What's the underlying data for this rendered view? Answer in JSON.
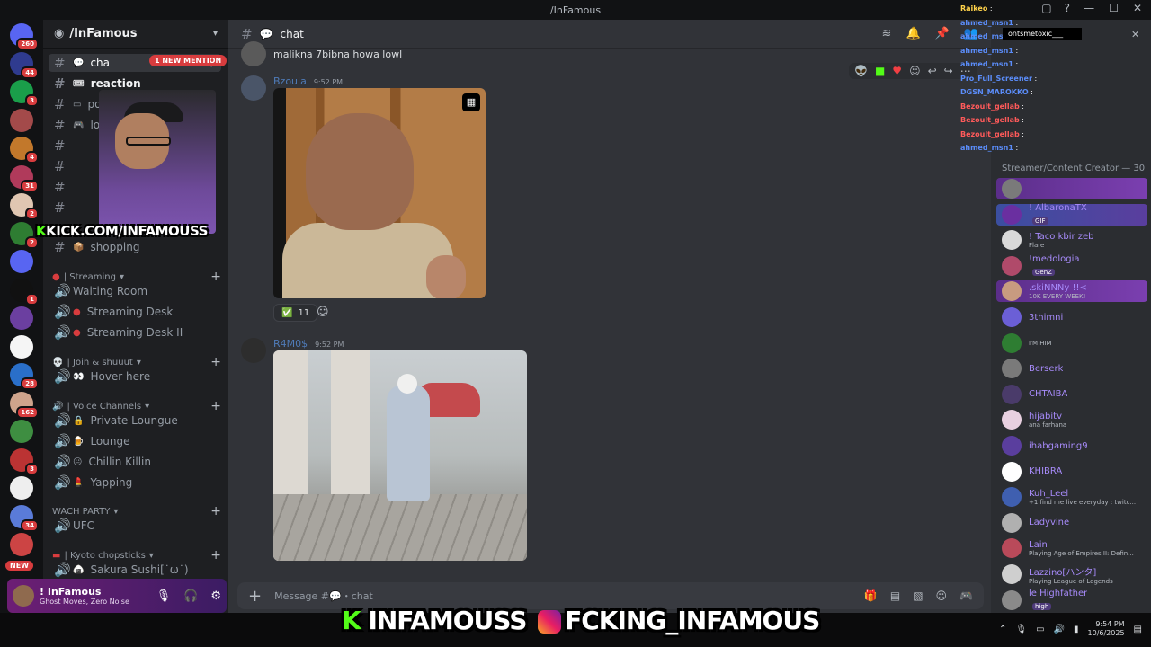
{
  "window": {
    "title": "/InFamous"
  },
  "rail": {
    "badges": [
      "260",
      "44",
      "3",
      "",
      "4",
      "31",
      "2",
      "2",
      "",
      "1",
      "",
      "",
      "28",
      "162",
      "",
      "3",
      "",
      "34",
      ""
    ],
    "new_label": "NEW",
    "colors": [
      "#5865f2",
      "#2f3b8f",
      "#1a9e4a",
      "#a34a4a",
      "#c2782b",
      "#b03a5b",
      "#e0c6b2",
      "#2e7d32",
      "#5865f2",
      "#111",
      "#6b3fa0",
      "#f5f5f5",
      "#2a6fc9",
      "#cfa48c",
      "#3e8e41",
      "#b33",
      "#eee",
      "#5a7bd8",
      "#c44"
    ]
  },
  "server": {
    "name": "/InFamous"
  },
  "channels": {
    "mention_pill": "1 NEW MENTION",
    "text": [
      {
        "name": "cha",
        "active": true
      },
      {
        "name": "reaction",
        "bold": true
      },
      {
        "name": "pov"
      },
      {
        "name": "looking-f"
      },
      {
        "name": "shopping"
      }
    ],
    "categories": [
      {
        "label": "| Streaming",
        "items": [
          "Waiting Room",
          "Streaming Desk",
          "Streaming Desk II"
        ]
      },
      {
        "label": "| Join & shuuut",
        "items": [
          "Hover here"
        ]
      },
      {
        "label": "| Voice Channels",
        "items": [
          "Private Loungue",
          "Lounge",
          "Chillin Killin",
          "Yapping"
        ]
      },
      {
        "label": "WACH PARTY",
        "items": [
          "UFC"
        ]
      },
      {
        "label": "| Kyoto chopsticks",
        "items": [
          "Sakura Sushi[˙ω˙)"
        ]
      }
    ]
  },
  "user_panel": {
    "name": "! InFamous",
    "status": "Ghost Moves, Zero Noise"
  },
  "overlay": {
    "kick_url": "KICK.COM/INFAMOUSS",
    "banner_kick": "INFAMOUSS",
    "banner_ig": "FCKING_INFAMOUS"
  },
  "chat": {
    "channel": "chat",
    "prev_message": "malikna 7bibna howa lowl",
    "messages": [
      {
        "author": "Bzoula",
        "time": "9:52 PM"
      },
      {
        "author": "R4M0$",
        "time": "9:52 PM"
      }
    ],
    "reaction": {
      "emoji": "✅",
      "count": "11"
    },
    "composer_placeholder": "Message #💬・chat"
  },
  "members": {
    "category": "Streamer/Content Creator — 30",
    "list": [
      {
        "name": "",
        "sub": "",
        "color": "#7a7a7a",
        "hl": true
      },
      {
        "name": "! AlbaronaTX",
        "sub": "",
        "tag": "GIF",
        "color": "#6a2fa0",
        "hl2": true
      },
      {
        "name": "! Taco kbir zeb",
        "sub": "Flare",
        "color": "#d9d9d9"
      },
      {
        "name": "!medologia",
        "sub": "",
        "tag": "GenZ",
        "color": "#b04a6a"
      },
      {
        "name": ".skiNNNy !!<",
        "sub": "10K EVERY WEEK!",
        "color": "#c89b80",
        "hl": true
      },
      {
        "name": "3thimni",
        "sub": "",
        "color": "#6b5fd6"
      },
      {
        "name": "",
        "sub": "I'M HIM",
        "color": "#2e7d32"
      },
      {
        "name": "Berserk",
        "sub": "",
        "color": "#7a7a7a"
      },
      {
        "name": "CHTAIBA",
        "sub": "",
        "color": "#4a3b6a"
      },
      {
        "name": "hijabitv",
        "sub": "ana farhana",
        "color": "#e8d0e0"
      },
      {
        "name": "ihabgaming9",
        "sub": "",
        "color": "#5a3e9e"
      },
      {
        "name": "KHIBRA",
        "sub": "",
        "color": "#ffffff"
      },
      {
        "name": "Kuh_Leel",
        "sub": "+1 find me live everyday : twitc...",
        "color": "#3f5fb0"
      },
      {
        "name": "Ladyvine",
        "sub": "",
        "color": "#b0b0b0"
      },
      {
        "name": "Lain",
        "sub": "Playing Age of Empires II: Defin...",
        "color": "#b94a5a"
      },
      {
        "name": "Lazzino[ハンタ]",
        "sub": "Playing League of Legends",
        "color": "#cfcfcf"
      },
      {
        "name": "le Highfather",
        "sub": "",
        "tag": "high",
        "color": "#8a8a8a"
      }
    ]
  },
  "stream_chat": [
    {
      "user": "Raikeo",
      "cls": "y",
      "text": ""
    },
    {
      "user": "ahmed_msn1",
      "cls": "",
      "text": ""
    },
    {
      "user": "ahmed_msn1",
      "cls": "",
      "text": ""
    },
    {
      "user": "ahmed_msn1",
      "cls": "",
      "text": ""
    },
    {
      "user": "ahmed_msn1",
      "cls": "",
      "text": ""
    },
    {
      "user": "Pro_Full_Screener",
      "cls": "",
      "text": ""
    },
    {
      "user": "DGSN_MAROKKO",
      "cls": "",
      "text": ""
    },
    {
      "user": "Bezoult_gellab",
      "cls": "r",
      "text": ""
    },
    {
      "user": "Bezoult_gellab",
      "cls": "r",
      "text": ""
    },
    {
      "user": "Bezoult_gellab",
      "cls": "r",
      "text": ""
    },
    {
      "user": "ahmed_msn1",
      "cls": "",
      "text": ""
    }
  ],
  "search_overlay": "ontsmetoxic___",
  "tray": {
    "time": "9:54 PM",
    "date": "10/6/2025"
  }
}
